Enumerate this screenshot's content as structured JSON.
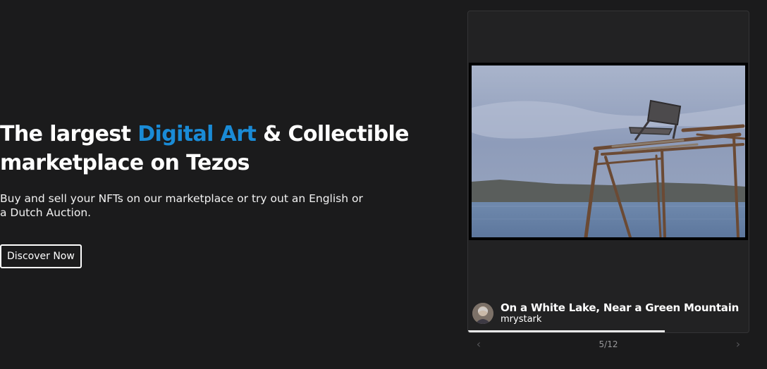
{
  "hero": {
    "headline_part1": "The largest ",
    "headline_accent": "Digital Art",
    "headline_part2": " & Collectible marketplace on Tezos",
    "subtext": "Buy and sell your NFTs on our marketplace or try out an English or a Dutch Auction.",
    "cta_label": "Discover Now"
  },
  "carousel": {
    "artwork_title": "On a White Lake, Near a Green Mountain",
    "artist": "mrystark",
    "counter": "5/12",
    "progress": 0.7,
    "prev_icon": "chevron-left-icon",
    "next_icon": "chevron-right-icon"
  },
  "colors": {
    "background": "#1b1b1c",
    "accent": "#1a8bd6",
    "card": "#222223"
  }
}
